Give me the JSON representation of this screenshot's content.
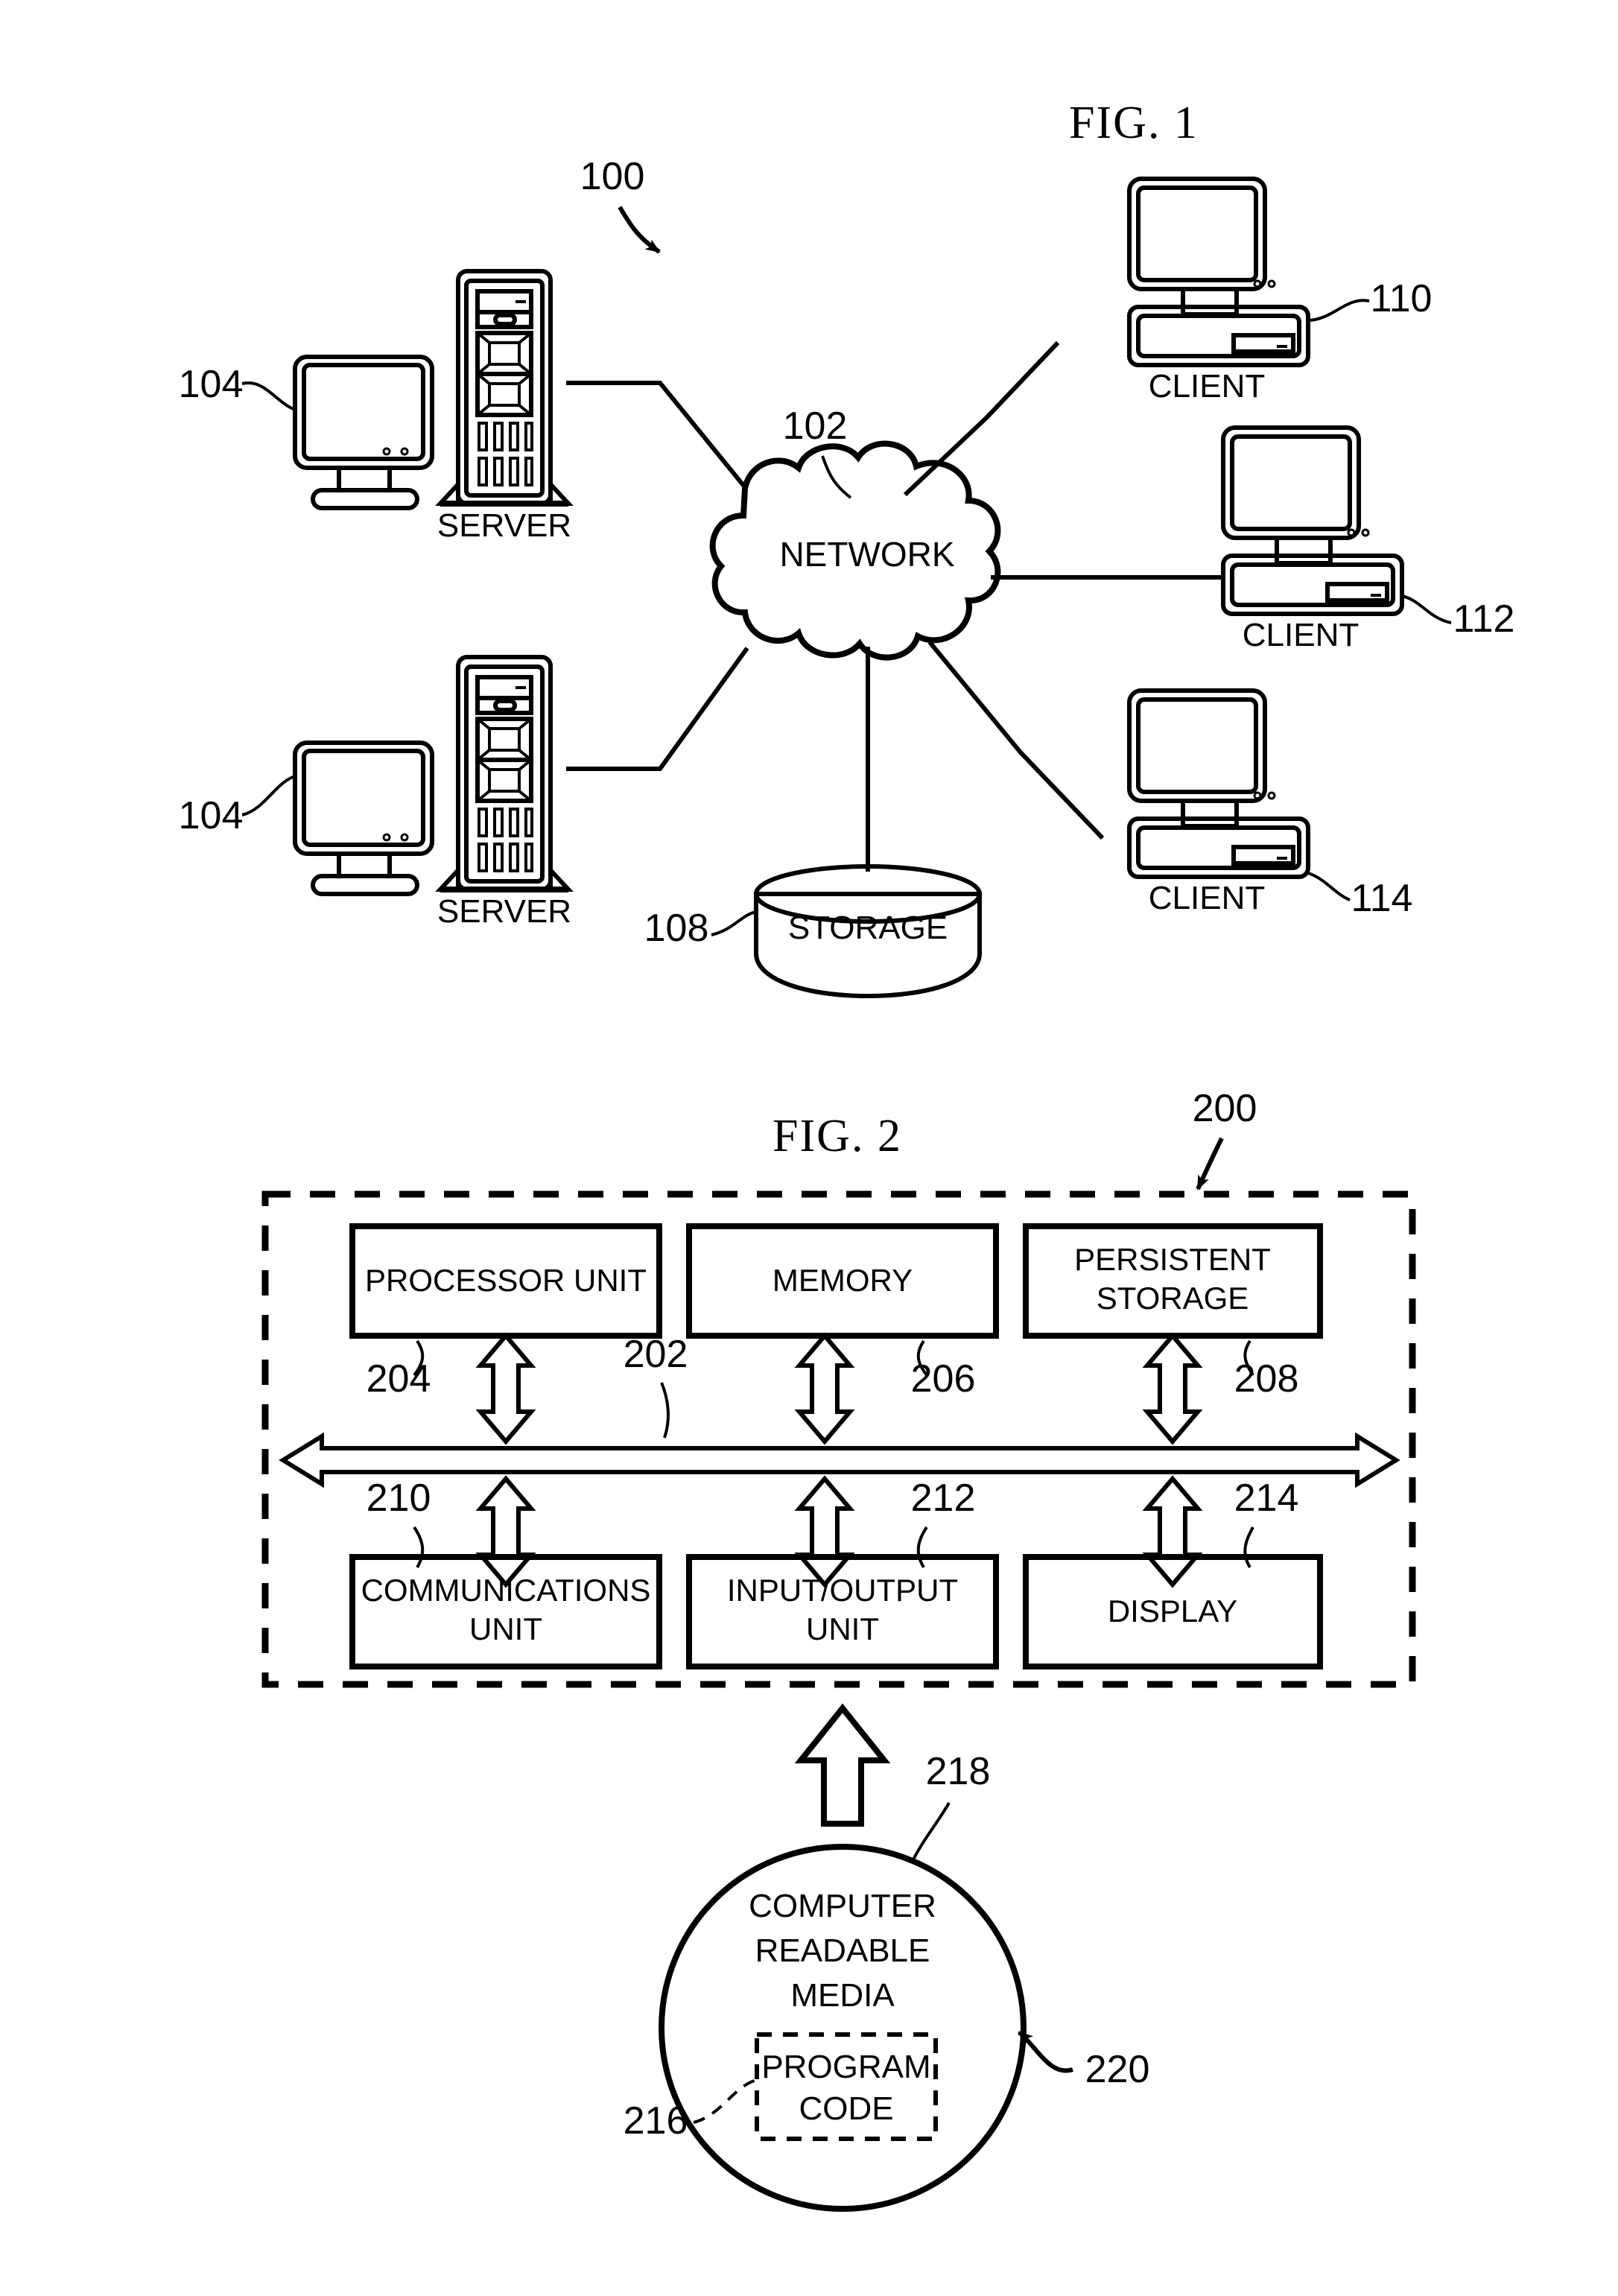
{
  "figure1": {
    "title": "FIG. 1",
    "system_ref": "100",
    "network": {
      "label": "NETWORK",
      "ref": "102"
    },
    "storage": {
      "label": "STORAGE",
      "ref": "108"
    },
    "servers": [
      {
        "label": "SERVER",
        "ref": "104"
      },
      {
        "label": "SERVER",
        "ref": "104"
      }
    ],
    "clients": [
      {
        "label": "CLIENT",
        "ref": "110"
      },
      {
        "label": "CLIENT",
        "ref": "112"
      },
      {
        "label": "CLIENT",
        "ref": "114"
      }
    ]
  },
  "figure2": {
    "title": "FIG. 2",
    "system_ref": "200",
    "bus_ref": "202",
    "top_blocks": [
      {
        "label_line1": "PROCESSOR UNIT",
        "label_line2": "",
        "ref": "204"
      },
      {
        "label_line1": "MEMORY",
        "label_line2": "",
        "ref": "206"
      },
      {
        "label_line1": "PERSISTENT",
        "label_line2": "STORAGE",
        "ref": "208"
      }
    ],
    "bottom_blocks": [
      {
        "label_line1": "COMMUNICATIONS",
        "label_line2": "UNIT",
        "ref": "210"
      },
      {
        "label_line1": "INPUT/OUTPUT",
        "label_line2": "UNIT",
        "ref": "212"
      },
      {
        "label_line1": "DISPLAY",
        "label_line2": "",
        "ref": "214"
      }
    ],
    "media": {
      "label_line1": "COMPUTER",
      "label_line2": "READABLE",
      "label_line3": "MEDIA",
      "ref": "218",
      "product_ref": "220",
      "program_code": {
        "label_line1": "PROGRAM",
        "label_line2": "CODE",
        "ref": "216"
      }
    }
  },
  "colors": {
    "ink": "#000000",
    "paper": "#ffffff"
  }
}
